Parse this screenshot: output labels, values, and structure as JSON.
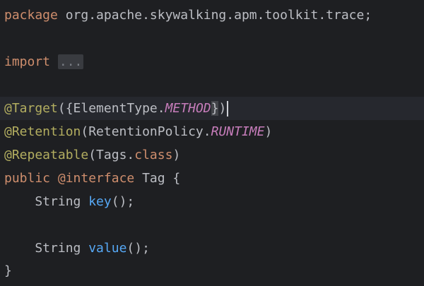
{
  "code": {
    "line1": {
      "kw": "package",
      "rest": " org.apache.skywalking.apm.toolkit.trace;"
    },
    "line3": {
      "kw": "import",
      "fold": "..."
    },
    "line5": {
      "ann": "@Target",
      "open": "({",
      "type": "ElementType.",
      "const": "METHOD",
      "close_brace": "}",
      "close_paren": ")"
    },
    "line6": {
      "ann": "@Retention",
      "open": "(RetentionPolicy.",
      "const": "RUNTIME",
      "close": ")"
    },
    "line7": {
      "ann": "@Repeatable",
      "open": "(Tags.",
      "kw": "class",
      "close": ")"
    },
    "line8": {
      "kw1": "public",
      "ann": "@interface",
      "name": " Tag {"
    },
    "line9": {
      "type": "    String ",
      "method": "key",
      "rest": "();"
    },
    "line11": {
      "type": "    String ",
      "method": "value",
      "rest": "();"
    },
    "line12": {
      "close": "}"
    }
  },
  "colors": {
    "background": "#1e1f22",
    "current_line": "#26282e",
    "keyword": "#cf8e6d",
    "annotation": "#b3ae60",
    "method": "#56a8f5",
    "constant": "#c77dbb",
    "text": "#bcbec4"
  }
}
